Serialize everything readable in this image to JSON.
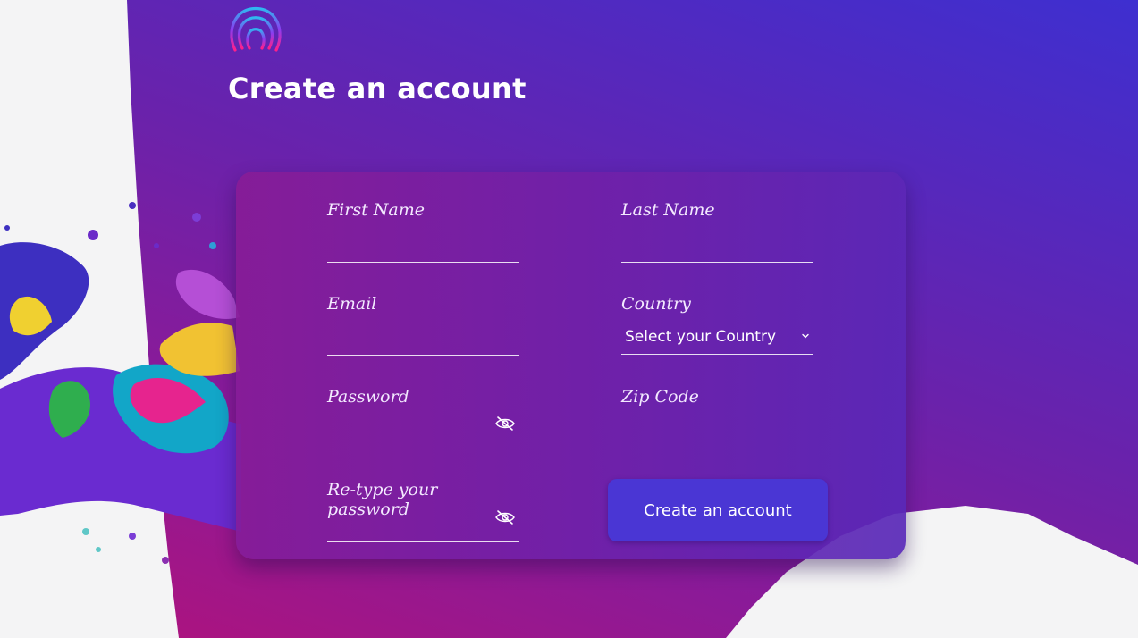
{
  "header": {
    "title": "Create an account",
    "logo_icon": "fingerprint-arc-logo"
  },
  "form": {
    "first_name": {
      "label": "First Name",
      "value": ""
    },
    "last_name": {
      "label": "Last Name",
      "value": ""
    },
    "email": {
      "label": "Email",
      "value": ""
    },
    "country": {
      "label": "Country",
      "selected": "Select your Country"
    },
    "password": {
      "label": "Password",
      "value": "",
      "toggle_icon": "eye-slash-icon"
    },
    "zip_code": {
      "label": "Zip Code",
      "value": ""
    },
    "retype_password": {
      "label": "Re-type your password",
      "value": "",
      "toggle_icon": "eye-slash-icon"
    },
    "submit_label": "Create an account"
  },
  "colors": {
    "gradient_start": "#b3127a",
    "gradient_end": "#3e2fd0",
    "button": "#4a36d4",
    "background": "#f4f4f5"
  }
}
